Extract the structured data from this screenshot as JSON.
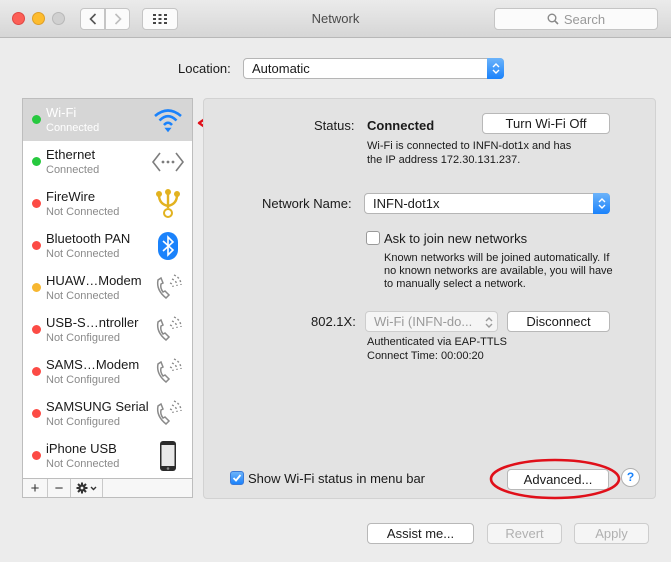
{
  "window": {
    "title": "Network",
    "search_placeholder": "Search"
  },
  "location": {
    "label": "Location:",
    "value": "Automatic"
  },
  "services": [
    {
      "name": "Wi-Fi",
      "status": "Connected",
      "dot": "#27c93f",
      "icon": "wifi-icon"
    },
    {
      "name": "Ethernet",
      "status": "Connected",
      "dot": "#27c93f",
      "icon": "ethernet-icon"
    },
    {
      "name": "FireWire",
      "status": "Not Connected",
      "dot": "#fc4b45",
      "icon": "firewire-icon"
    },
    {
      "name": "Bluetooth PAN",
      "status": "Not Connected",
      "dot": "#fc4b45",
      "icon": "bluetooth-icon"
    },
    {
      "name": "HUAW…Modem",
      "status": "Not Connected",
      "dot": "#f7b731",
      "icon": "phone-icon"
    },
    {
      "name": "USB-S…ntroller",
      "status": "Not Configured",
      "dot": "#fc4b45",
      "icon": "phone-icon"
    },
    {
      "name": "SAMS…Modem",
      "status": "Not Configured",
      "dot": "#fc4b45",
      "icon": "phone-icon"
    },
    {
      "name": "SAMSUNG Serial",
      "status": "Not Configured",
      "dot": "#fc4b45",
      "icon": "phone-icon"
    },
    {
      "name": "iPhone USB",
      "status": "Not Connected",
      "dot": "#fc4b45",
      "icon": "iphone-icon"
    }
  ],
  "detail": {
    "status_label": "Status:",
    "status_value": "Connected",
    "turn_off_button": "Turn Wi-Fi Off",
    "status_desc_1": "Wi-Fi is connected to INFN-dot1x and has",
    "status_desc_2": "the IP address 172.30.131.237.",
    "network_name_label": "Network Name:",
    "network_name_value": "INFN-dot1x",
    "ask_join_label": "Ask to join new networks",
    "ask_join_desc_1": "Known networks will be joined automatically. If",
    "ask_join_desc_2": "no known networks are available, you will have",
    "ask_join_desc_3": "to manually select a network.",
    "dot1x_label": "802.1X:",
    "dot1x_value": "Wi-Fi (INFN-do...",
    "disconnect_button": "Disconnect",
    "auth_text": "Authenticated via EAP-TTLS",
    "connect_time": "Connect Time: 00:00:20",
    "show_status_label": "Show Wi-Fi status in menu bar",
    "advanced_button": "Advanced...",
    "help": "?"
  },
  "footer": {
    "assist_button": "Assist me...",
    "revert_button": "Revert",
    "apply_button": "Apply"
  },
  "toolbar": {
    "add": "+",
    "remove": "−"
  },
  "colors": {
    "accent": "#1a82fb",
    "annotation": "#e0101a"
  }
}
